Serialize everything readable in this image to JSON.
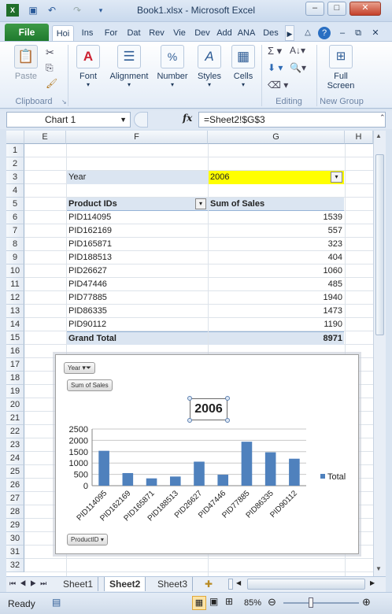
{
  "window": {
    "title": "Book1.xlsx - Microsoft Excel",
    "controls": {
      "minimize": "–",
      "maximize": "□",
      "close": "✕"
    }
  },
  "ribbon": {
    "file_tab": "File",
    "tabs": [
      "Hoi",
      "Ins",
      "For",
      "Dat",
      "Rev",
      "Vie",
      "Dev",
      "Add",
      "ANA",
      "Des"
    ],
    "groups": {
      "clipboard": {
        "label": "Clipboard",
        "paste": "Paste"
      },
      "font": {
        "label": "Font"
      },
      "alignment": {
        "label": "Alignment"
      },
      "number": {
        "label": "Number"
      },
      "styles": {
        "label": "Styles"
      },
      "cells": {
        "label": "Cells"
      },
      "editing": {
        "label": "Editing"
      },
      "new_group": {
        "label": "New Group",
        "full_screen_1": "Full",
        "full_screen_2": "Screen"
      }
    }
  },
  "formula_bar": {
    "name_box": "Chart 1",
    "fx_label": "fx",
    "formula": "=Sheet2!$G$3"
  },
  "grid": {
    "columns": [
      "E",
      "F",
      "G",
      "H"
    ],
    "rows": [
      "1",
      "2",
      "3",
      "4",
      "5",
      "6",
      "7",
      "8",
      "9",
      "10",
      "11",
      "12",
      "13",
      "14",
      "15",
      "16",
      "17",
      "18",
      "19",
      "20",
      "21",
      "22",
      "23",
      "24",
      "25",
      "26",
      "27",
      "28",
      "29",
      "30",
      "31",
      "32"
    ],
    "filter_label": "Year",
    "filter_value": "2006",
    "pivot_header_ids": "Product IDs",
    "pivot_header_sales": "Sum of Sales",
    "pivot_rows": [
      {
        "id": "PID114095",
        "sales": "1539"
      },
      {
        "id": "PID162169",
        "sales": "557"
      },
      {
        "id": "PID165871",
        "sales": "323"
      },
      {
        "id": "PID188513",
        "sales": "404"
      },
      {
        "id": "PID26627",
        "sales": "1060"
      },
      {
        "id": "PID47446",
        "sales": "485"
      },
      {
        "id": "PID77885",
        "sales": "1940"
      },
      {
        "id": "PID86335",
        "sales": "1473"
      },
      {
        "id": "PID90112",
        "sales": "1190"
      }
    ],
    "grand_total_label": "Grand Total",
    "grand_total_value": "8971"
  },
  "chart_data": {
    "type": "bar",
    "title": "2006",
    "categories": [
      "PID114095",
      "PID162169",
      "PID165871",
      "PID188513",
      "PID26627",
      "PID47446",
      "PID77885",
      "PID86335",
      "PID90112"
    ],
    "series": [
      {
        "name": "Total",
        "values": [
          1539,
          557,
          323,
          404,
          1060,
          485,
          1940,
          1473,
          1190
        ],
        "color": "#4f81bd"
      }
    ],
    "ylim": [
      0,
      2500
    ],
    "yticks": [
      "0",
      "500",
      "1000",
      "1500",
      "2000",
      "2500"
    ],
    "grid": true,
    "legend": "right",
    "field_buttons": {
      "year": "Year",
      "sum": "Sum of Sales",
      "product": "ProductID"
    }
  },
  "sheets": {
    "tabs": [
      "Sheet1",
      "Sheet2",
      "Sheet3"
    ],
    "active": "Sheet2"
  },
  "status": {
    "ready": "Ready",
    "zoom": "85%"
  }
}
